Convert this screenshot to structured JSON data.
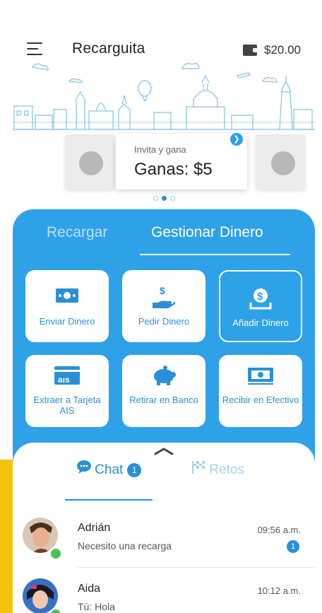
{
  "app": {
    "title": "Recarguita",
    "balance": "$20.00"
  },
  "promo": {
    "subtitle": "Invita y gana",
    "headline": "Ganas: $5"
  },
  "tabs": {
    "recargar": "Recargar",
    "gestionar": "Gestionar Dinero"
  },
  "actions": [
    {
      "label": "Enviar Dinero",
      "icon": "money-bill-icon"
    },
    {
      "label": "Pedir Dinero",
      "icon": "hand-dollar-icon"
    },
    {
      "label": "Añadir Dinero",
      "icon": "add-money-icon"
    },
    {
      "label": "Extraer a Tarjeta AIS",
      "icon": "ais-card-icon"
    },
    {
      "label": "Retirar en Banco",
      "icon": "piggy-bank-icon"
    },
    {
      "label": "Recibir en Efectivo",
      "icon": "cash-icon"
    }
  ],
  "chat_section": {
    "chat_label": "Chat",
    "chat_badge": "1",
    "retos_label": "Retos"
  },
  "conversations": [
    {
      "name": "Adrián",
      "message": "Necesito una recarga",
      "time": "09:56 a.m.",
      "unread": "1"
    },
    {
      "name": "Aida",
      "message": "Tú: Hola",
      "time": "10:12 a.m."
    }
  ],
  "colors": {
    "primary": "#2ea1e9",
    "accent_dark": "#2a8fd8",
    "online": "#47c35a"
  }
}
